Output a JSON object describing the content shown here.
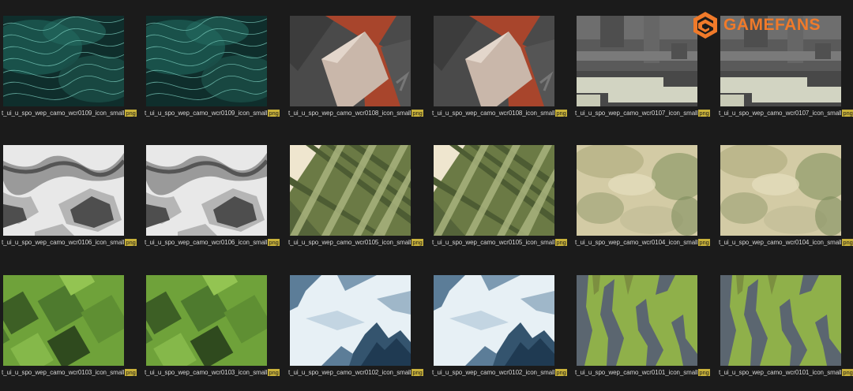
{
  "brand": {
    "name": "GAMEFANS",
    "accent": "#f07a2a"
  },
  "files": [
    {
      "name": "t_ui_u_spo_wep_camo_wcr0109_icon_small",
      "ext": "png",
      "pattern": "teal-waves"
    },
    {
      "name": "t_ui_u_spo_wep_camo_wcr0109_icon_small",
      "ext": "png",
      "pattern": "teal-waves"
    },
    {
      "name": "t_ui_u_spo_wep_camo_wcr0108_icon_small",
      "ext": "png",
      "pattern": "rust-shards"
    },
    {
      "name": "t_ui_u_spo_wep_camo_wcr0108_icon_small",
      "ext": "png",
      "pattern": "rust-shards"
    },
    {
      "name": "t_ui_u_spo_wep_camo_wcr0107_icon_small",
      "ext": "png",
      "pattern": "grey-blocks"
    },
    {
      "name": "t_ui_u_spo_wep_camo_wcr0107_icon_small",
      "ext": "png",
      "pattern": "grey-blocks"
    },
    {
      "name": "t_ui_u_spo_wep_camo_wcr0106_icon_small",
      "ext": "png",
      "pattern": "urban-grey"
    },
    {
      "name": "t_ui_u_spo_wep_camo_wcr0106_icon_small",
      "ext": "png",
      "pattern": "urban-grey"
    },
    {
      "name": "t_ui_u_spo_wep_camo_wcr0105_icon_small",
      "ext": "png",
      "pattern": "olive-stripes"
    },
    {
      "name": "t_ui_u_spo_wep_camo_wcr0105_icon_small",
      "ext": "png",
      "pattern": "olive-stripes"
    },
    {
      "name": "t_ui_u_spo_wep_camo_wcr0104_icon_small",
      "ext": "png",
      "pattern": "sand-haze"
    },
    {
      "name": "t_ui_u_spo_wep_camo_wcr0104_icon_small",
      "ext": "png",
      "pattern": "sand-haze"
    },
    {
      "name": "t_ui_u_spo_wep_camo_wcr0103_icon_small",
      "ext": "png",
      "pattern": "green-squares"
    },
    {
      "name": "t_ui_u_spo_wep_camo_wcr0103_icon_small",
      "ext": "png",
      "pattern": "green-squares"
    },
    {
      "name": "t_ui_u_spo_wep_camo_wcr0102_icon_small",
      "ext": "png",
      "pattern": "snow-peaks"
    },
    {
      "name": "t_ui_u_spo_wep_camo_wcr0102_icon_small",
      "ext": "png",
      "pattern": "snow-peaks"
    },
    {
      "name": "t_ui_u_spo_wep_camo_wcr0101_icon_small",
      "ext": "png",
      "pattern": "lime-tiger"
    },
    {
      "name": "t_ui_u_spo_wep_camo_wcr0101_icon_small",
      "ext": "png",
      "pattern": "lime-tiger"
    }
  ]
}
